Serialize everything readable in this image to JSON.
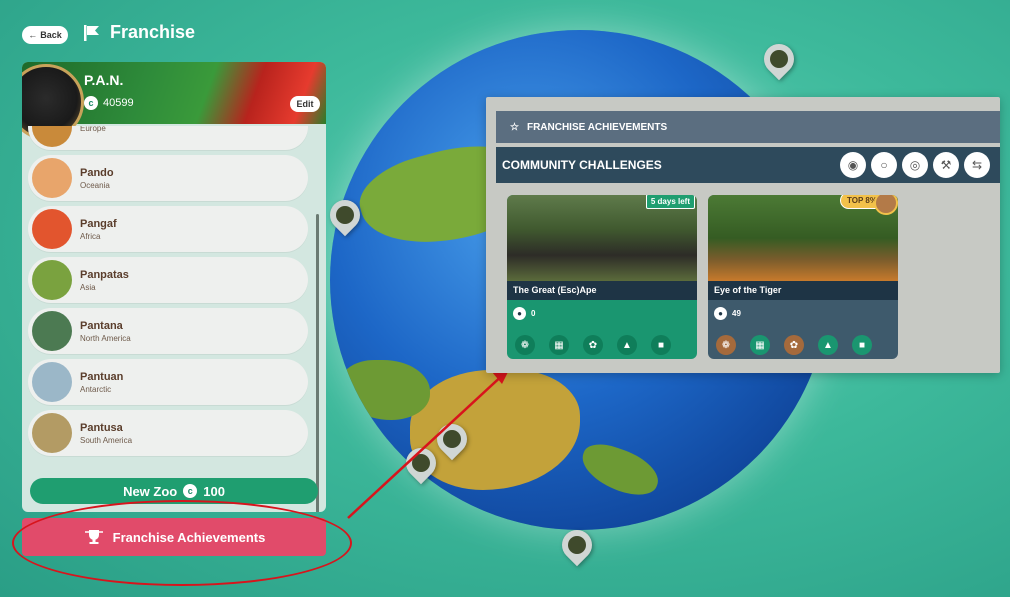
{
  "header": {
    "back_label": "Back",
    "title": "Franchise"
  },
  "profile": {
    "name": "P.A.N.",
    "coins": "40599",
    "edit_label": "Edit"
  },
  "zoos": [
    {
      "name": "",
      "region": "Europe",
      "color": "#c98a3a"
    },
    {
      "name": "Pando",
      "region": "Oceania",
      "color": "#e8a56b"
    },
    {
      "name": "Pangaf",
      "region": "Africa",
      "color": "#e2552e"
    },
    {
      "name": "Panpatas",
      "region": "Asia",
      "color": "#7aa23f"
    },
    {
      "name": "Pantana",
      "region": "North America",
      "color": "#4c7a52"
    },
    {
      "name": "Pantuan",
      "region": "Antarctic",
      "color": "#9bb7c8"
    },
    {
      "name": "Pantusa",
      "region": "South America",
      "color": "#b39b64"
    }
  ],
  "new_zoo": {
    "label": "New Zoo",
    "cost": "100"
  },
  "franchise_button": {
    "label": "Franchise Achievements"
  },
  "achievements": {
    "header": "FRANCHISE ACHIEVEMENTS",
    "section_title": "COMMUNITY CHALLENGES",
    "challenges": [
      {
        "name": "The Great (Esc)Ape",
        "participants": "0",
        "badge": "5 days left"
      },
      {
        "name": "Eye of the Tiger",
        "participants": "49",
        "badge": "TOP 8%"
      }
    ]
  },
  "icons": {
    "currency": "c",
    "filter_icons": [
      "animal-icon",
      "medal-icon",
      "globe-icon",
      "gavel-icon",
      "swap-icon"
    ]
  }
}
